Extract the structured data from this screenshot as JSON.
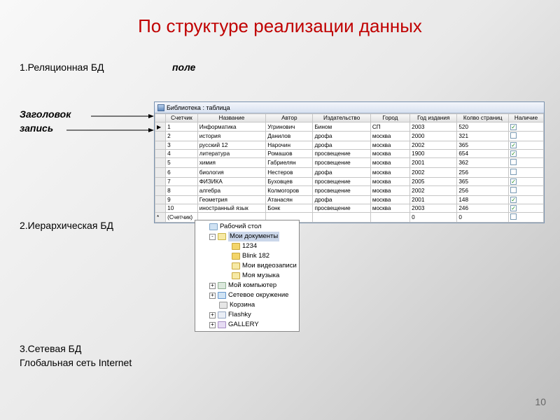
{
  "title": "По структуре реализации данных",
  "labels": {
    "relational": "1.Реляционная БД",
    "pole": "поле",
    "zagolovok": "Заголовок",
    "zapis": "запись",
    "hierarchical": "2.Иерархическая БД",
    "network": "3.Сетевая БД",
    "internet": "Глобальная сеть Internet"
  },
  "table": {
    "window_title": "Библиотека : таблица",
    "headers": [
      "",
      "Счетчик",
      "Название",
      "Автор",
      "Издательство",
      "Город",
      "Год издания",
      "Колво страниц",
      "Наличие"
    ],
    "rows": [
      {
        "n": "1",
        "name": "Информатика",
        "author": "Угринович",
        "pub": "Бином",
        "city": "СП",
        "year": "2003",
        "pages": "520",
        "avail": true
      },
      {
        "n": "2",
        "name": "история",
        "author": "Данилов",
        "pub": "дрофа",
        "city": "москва",
        "year": "2000",
        "pages": "321",
        "avail": false
      },
      {
        "n": "3",
        "name": "русский 12",
        "author": "Нарочин",
        "pub": "дрофа",
        "city": "москва",
        "year": "2002",
        "pages": "365",
        "avail": true
      },
      {
        "n": "4",
        "name": "литература",
        "author": "Ромашов",
        "pub": "просвещение",
        "city": "москва",
        "year": "1900",
        "pages": "654",
        "avail": true
      },
      {
        "n": "5",
        "name": "химия",
        "author": "Габриелян",
        "pub": "просвещение",
        "city": "москва",
        "year": "2001",
        "pages": "362",
        "avail": false
      },
      {
        "n": "6",
        "name": "биология",
        "author": "Нестеров",
        "pub": "дрофа",
        "city": "москва",
        "year": "2002",
        "pages": "256",
        "avail": false
      },
      {
        "n": "7",
        "name": "ФИЗИКА",
        "author": "Буховцев",
        "pub": "просвещение",
        "city": "москва",
        "year": "2005",
        "pages": "365",
        "avail": true
      },
      {
        "n": "8",
        "name": "алгебра",
        "author": "Колмогоров",
        "pub": "просвещение",
        "city": "москва",
        "year": "2002",
        "pages": "256",
        "avail": false
      },
      {
        "n": "9",
        "name": "Геометрия",
        "author": "Атанасян",
        "pub": "дрофа",
        "city": "москва",
        "year": "2001",
        "pages": "148",
        "avail": true
      },
      {
        "n": "10",
        "name": "иностранный язык",
        "author": "Бонк",
        "pub": "просвещение",
        "city": "москва",
        "year": "2003",
        "pages": "246",
        "avail": true
      }
    ],
    "footer_label": "(Счетчик)",
    "footer_zero": "0"
  },
  "tree": {
    "nodes": [
      {
        "lvl": 1,
        "exp": "",
        "icon": "desktop",
        "label": "Рабочий стол",
        "sel": false
      },
      {
        "lvl": 2,
        "exp": "-",
        "icon": "mydocs",
        "label": "Мои документы",
        "sel": true
      },
      {
        "lvl": 3,
        "exp": "",
        "icon": "folder",
        "label": "1234",
        "sel": false
      },
      {
        "lvl": 3,
        "exp": "",
        "icon": "folder",
        "label": "Blink 182",
        "sel": false
      },
      {
        "lvl": 3,
        "exp": "",
        "icon": "video",
        "label": "Мои видеозаписи",
        "sel": false
      },
      {
        "lvl": 3,
        "exp": "",
        "icon": "music",
        "label": "Моя музыка",
        "sel": false
      },
      {
        "lvl": 2,
        "exp": "+",
        "icon": "computer",
        "label": "Мой компьютер",
        "sel": false
      },
      {
        "lvl": 2,
        "exp": "+",
        "icon": "network",
        "label": "Сетевое окружение",
        "sel": false
      },
      {
        "lvl": 2,
        "exp": "",
        "icon": "trash",
        "label": "Корзина",
        "sel": false
      },
      {
        "lvl": 2,
        "exp": "+",
        "icon": "flash",
        "label": "Flashky",
        "sel": false
      },
      {
        "lvl": 2,
        "exp": "+",
        "icon": "gallery",
        "label": "GALLERY",
        "sel": false
      }
    ]
  },
  "page_number": "10"
}
